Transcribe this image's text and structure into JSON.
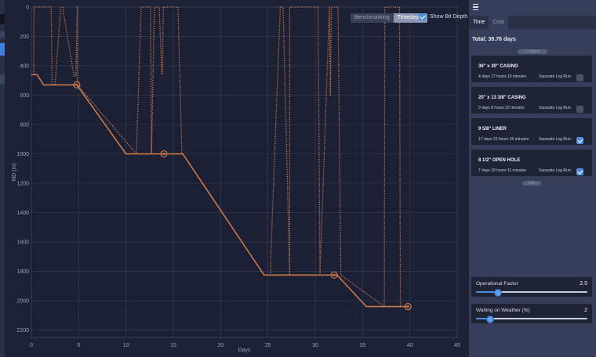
{
  "chart_data": {
    "type": "line",
    "xlabel": "Days",
    "ylabel": "MD (m)",
    "xlim": [
      0,
      45
    ],
    "ylim": [
      2250,
      0
    ],
    "xticks": [
      0,
      5,
      10,
      15,
      20,
      25,
      30,
      35,
      40,
      45
    ],
    "yticks": [
      0,
      200,
      400,
      600,
      800,
      1000,
      1200,
      1400,
      1600,
      1800,
      2000,
      2200
    ],
    "grid": true,
    "series": [
      {
        "style": "solid",
        "color": "#c9794a",
        "x": [
          0,
          0.6,
          1.3,
          4.8,
          10,
          10.9,
          16,
          24.6,
          25.3,
          32.3,
          35.4,
          36,
          39.8
        ],
        "y": [
          460,
          460,
          530,
          530,
          1000,
          1000,
          1000,
          1825,
          1825,
          1825,
          2040,
          2040,
          2040
        ]
      },
      {
        "style": "dotted",
        "color": "#c9794a",
        "x": [
          0.25,
          0.25,
          0.28,
          0.3,
          2.1,
          2.2,
          2.5,
          3.1,
          3.15,
          3.3,
          4.5,
          4.7,
          4.85,
          4.85,
          11.1,
          11.6,
          12.6,
          12.7,
          13.0,
          13.5,
          13.8,
          13.85,
          13.95,
          14.0,
          14.5,
          15.5,
          15.9,
          16.0,
          24.6,
          25.3,
          25.3,
          26.3,
          26.6,
          27.3,
          27.3,
          30.3,
          30.5,
          31.5,
          31.6,
          31.7,
          32.4,
          32.7,
          37.3,
          37.35,
          37.6,
          38.9,
          39.0
        ],
        "y": [
          460,
          400,
          0,
          0,
          0,
          530,
          530,
          0,
          0,
          0,
          470,
          470,
          0,
          530,
          1000,
          0,
          0,
          1000,
          0,
          0,
          460,
          460,
          0,
          0,
          0,
          0,
          1000,
          1000,
          1825,
          1825,
          1700,
          0,
          0,
          1825,
          0,
          0,
          1825,
          0,
          600,
          0,
          0,
          1825,
          2040,
          0,
          0,
          0,
          2040
        ],
        "points": []
      }
    ],
    "markers": [
      {
        "x": 4.8,
        "y": 530
      },
      {
        "x": 14.0,
        "y": 1000
      },
      {
        "x": 32.0,
        "y": 1825
      },
      {
        "x": 39.8,
        "y": 2040
      }
    ]
  },
  "toolbar": {
    "benchmarking_label": "Benchmarking",
    "timedepth_label": "Timedepth",
    "show_bit_depth_label": "Show Bit Depth",
    "show_bit_depth_checked": true
  },
  "panel": {
    "tabs": [
      "Time",
      "Cost"
    ],
    "active_tab": "Time",
    "total_label": "Total: 39.76 days",
    "top_pill": "Collapse",
    "bottom_pill": "Add",
    "separate_label": "Separate Log Run:",
    "sections": [
      {
        "title": "36\" x 30\" CASING",
        "duration": "4 days 17 hours 10 minutes",
        "checked": false
      },
      {
        "title": "20\" x 13 3/8\" CASING",
        "duration": "9 days 8 hours 22 minutes",
        "checked": false
      },
      {
        "title": "9 5/8\" LINER",
        "duration": "17 days 22 hours 25 minutes",
        "checked": true
      },
      {
        "title": "8 1/2\" OPEN HOLE",
        "duration": "7 days 18 hours 11 minutes",
        "checked": true
      }
    ],
    "sliders": [
      {
        "label": "Operational Factor",
        "value": "2.5",
        "fraction": 0.19
      },
      {
        "label": "Waiting on Weather (%)",
        "value": "2",
        "fraction": 0.12
      }
    ]
  },
  "colors": {
    "accent": "#4a90e2",
    "curve": "#c9794a"
  }
}
